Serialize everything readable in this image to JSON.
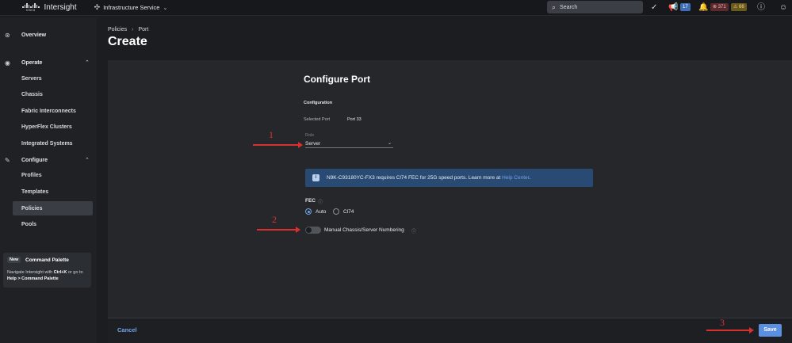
{
  "topbar": {
    "logo_word": "cisco",
    "app_name": "Intersight",
    "service": "Infrastructure Service",
    "search_placeholder": "Search",
    "notifications_count": "17",
    "alarms_critical": "371",
    "alarms_warning": "66"
  },
  "sidebar": {
    "overview": "Overview",
    "operate": {
      "label": "Operate",
      "items": [
        "Servers",
        "Chassis",
        "Fabric Interconnects",
        "HyperFlex Clusters",
        "Integrated Systems"
      ]
    },
    "configure": {
      "label": "Configure",
      "items": [
        "Profiles",
        "Templates",
        "Policies",
        "Pools"
      ],
      "active": "Policies"
    },
    "command_palette": {
      "badge": "New",
      "title": "Command Palette",
      "desc_pre": "Navigate Intersight with ",
      "shortcut": "Ctrl+K",
      "desc_mid": " or go to ",
      "path": "Help > Command Palette"
    }
  },
  "breadcrumb": [
    "Policies",
    "Port"
  ],
  "page_title": "Create",
  "form": {
    "heading": "Configure Port",
    "section": "Configuration",
    "selected_port_label": "Selected Port",
    "selected_port_value": "Port 33",
    "role_label": "Role",
    "role_value": "Server",
    "info_text": "N9K-C93180YC-FX3 requires Cl74 FEC for 25G speed ports. Learn more at",
    "info_link": "Help Center",
    "info_tail": ".",
    "fec_label": "FEC",
    "fec_options": [
      "Auto",
      "Cl74"
    ],
    "fec_selected": "Auto",
    "manual_numbering_label": "Manual Chassis/Server Numbering",
    "manual_numbering_on": false
  },
  "footer": {
    "cancel": "Cancel",
    "save": "Save"
  },
  "annotations": [
    "1",
    "2",
    "3"
  ],
  "colors": {
    "accent": "#6fa5ec",
    "save_button": "#5b8fe0",
    "annotation": "#d9302f",
    "info_banner": "#294a72"
  }
}
